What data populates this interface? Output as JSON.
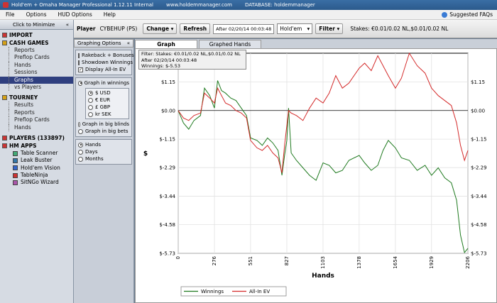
{
  "titlebar": {
    "title": "Hold'em + Omaha Manager Professional 1.12.11 Internal",
    "url": "www.holdemmanager.com",
    "database": "DATABASE: holdemmanager"
  },
  "menu": {
    "items": [
      "File",
      "Options",
      "HUD Options",
      "Help"
    ],
    "faq_label": "Suggested FAQs"
  },
  "sidebar": {
    "minimize_label": "Click to Minimize",
    "import_label": "IMPORT",
    "cash_label": "CASH GAMES",
    "cash_items": [
      "Reports",
      "Preflop Cards",
      "Hands",
      "Sessions",
      "Graphs",
      "vs Players"
    ],
    "tourney_label": "TOURNEY",
    "tourney_items": [
      "Results",
      "Reports",
      "Preflop Cards",
      "Hands"
    ],
    "players_label": "PLAYERS (133897)",
    "apps_label": "HM APPS",
    "apps": [
      "Table Scanner",
      "Leak Buster",
      "Hold'em Vision",
      "TableNinja",
      "SitNGo Wizard"
    ],
    "selected_item": "Graphs"
  },
  "toolbar": {
    "player_label": "Player",
    "player_value": "CYBEHUP (PS)",
    "change_label": "Change",
    "refresh_label": "Refresh",
    "date_value": "After 02/20/14 00:03:48",
    "game_value": "Hold'em",
    "filter_label": "Filter",
    "stakes_text": "Stakes: €0.01/0.02 NL,$0.01/0.02 NL"
  },
  "options": {
    "header": "Graphing Options",
    "checks": [
      {
        "label": "Rakeback + Bonuses",
        "checked": false
      },
      {
        "label": "Showdown Winnings",
        "checked": false
      },
      {
        "label": "Display All-In EV",
        "checked": true
      }
    ],
    "winnings_label": "Graph in winnings",
    "currencies": [
      "$ USD",
      "€ EUR",
      "£ GBP",
      "kr SEK"
    ],
    "blinds_label": "Graph in big blinds",
    "bets_label": "Graph in big bets",
    "xaxis_options": [
      "Hands",
      "Days",
      "Months"
    ]
  },
  "tabs": [
    "Graph",
    "Graphed Hands"
  ],
  "filter_info": {
    "line1": "Filter: Stakes: €0.01/0.02 NL,$0.01/0.02 NL",
    "line2": "After 02/20/14 00:03:48",
    "line3": "Winnings: $-5.53"
  },
  "colors": {
    "winnings": "#1f7a1f",
    "allin_ev": "#d42a2a",
    "selected_nav": "#2f3f7f"
  },
  "chart_data": {
    "type": "line",
    "xlabel": "Hands",
    "ylabel": "$",
    "xlim": [
      0,
      2206
    ],
    "ylim": [
      -5.73,
      2.3
    ],
    "x_ticks": [
      0,
      276,
      551,
      827,
      1103,
      1378,
      1654,
      1929,
      2206
    ],
    "y_ticks": [
      1.15,
      0.0,
      -1.15,
      -2.29,
      -3.44,
      -4.58,
      -5.73
    ],
    "y_tick_labels": [
      "$1.15",
      "$0.00",
      "$-1.15",
      "$-2.29",
      "$-3.44",
      "$-4.58",
      "$-5.73"
    ],
    "legend": "bottom-center",
    "series": [
      {
        "name": "Winnings",
        "x": [
          0,
          40,
          80,
          120,
          170,
          200,
          240,
          276,
          300,
          330,
          360,
          400,
          440,
          480,
          520,
          551,
          600,
          640,
          680,
          720,
          760,
          790,
          810,
          827,
          840,
          860,
          900,
          950,
          1000,
          1050,
          1103,
          1150,
          1200,
          1250,
          1300,
          1378,
          1420,
          1470,
          1520,
          1560,
          1600,
          1654,
          1700,
          1760,
          1820,
          1880,
          1929,
          1980,
          2030,
          2080,
          2120,
          2150,
          2180,
          2206
        ],
        "values": [
          0.0,
          -0.5,
          -0.75,
          -0.4,
          -0.2,
          0.9,
          0.6,
          0.1,
          1.2,
          0.8,
          0.7,
          0.5,
          0.4,
          0.1,
          -0.2,
          -1.1,
          -1.2,
          -1.4,
          -1.1,
          -1.3,
          -1.6,
          -2.6,
          -1.8,
          -1.2,
          0.1,
          -1.7,
          -2.0,
          -2.3,
          -2.6,
          -2.8,
          -2.1,
          -2.2,
          -2.5,
          -2.4,
          -2.0,
          -1.8,
          -2.1,
          -2.4,
          -2.2,
          -1.6,
          -1.2,
          -1.5,
          -1.9,
          -2.0,
          -2.4,
          -2.2,
          -2.6,
          -2.3,
          -2.7,
          -2.9,
          -3.6,
          -5.0,
          -5.7,
          -5.53
        ]
      },
      {
        "name": "All-In EV",
        "x": [
          0,
          40,
          80,
          120,
          170,
          200,
          240,
          276,
          300,
          330,
          360,
          400,
          440,
          480,
          520,
          551,
          600,
          640,
          680,
          720,
          760,
          790,
          810,
          827,
          840,
          860,
          900,
          950,
          1000,
          1050,
          1103,
          1150,
          1200,
          1250,
          1300,
          1378,
          1420,
          1470,
          1520,
          1560,
          1600,
          1654,
          1700,
          1760,
          1820,
          1880,
          1929,
          1980,
          2030,
          2080,
          2120,
          2150,
          2180,
          2206
        ],
        "values": [
          0.0,
          -0.3,
          -0.4,
          -0.2,
          -0.1,
          0.7,
          0.5,
          0.3,
          0.9,
          0.6,
          0.3,
          0.2,
          0.0,
          -0.1,
          -0.3,
          -1.2,
          -1.5,
          -1.6,
          -1.4,
          -1.7,
          -1.9,
          -2.5,
          -1.4,
          -0.6,
          0.0,
          -0.1,
          -0.2,
          -0.4,
          0.1,
          0.5,
          0.3,
          0.7,
          1.4,
          0.9,
          1.1,
          1.7,
          1.9,
          1.6,
          2.2,
          1.8,
          1.4,
          0.9,
          1.3,
          2.3,
          1.8,
          1.5,
          0.9,
          0.6,
          0.4,
          0.2,
          -0.5,
          -1.4,
          -2.0,
          -1.6
        ]
      }
    ]
  }
}
